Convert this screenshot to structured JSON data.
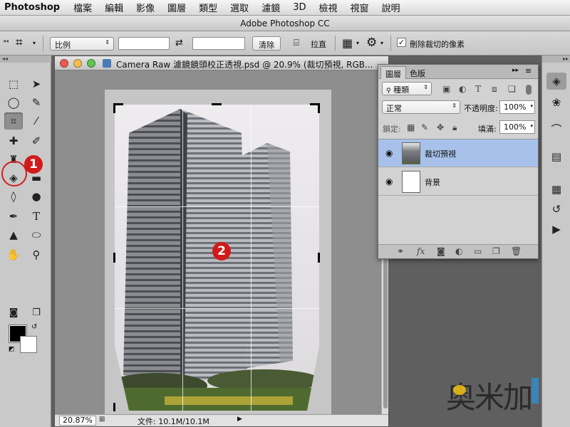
{
  "menubar": {
    "app": "Photoshop",
    "items": [
      "檔案",
      "編輯",
      "影像",
      "圖層",
      "類型",
      "選取",
      "濾鏡",
      "3D",
      "檢視",
      "視窗",
      "說明"
    ]
  },
  "window_title": "Adobe Photoshop CC",
  "options_bar": {
    "ratio_select": "比例",
    "clear_button": "清除",
    "straighten_label": "拉直",
    "delete_cropped_label": "刪除裁切的像素",
    "delete_cropped_checked": true
  },
  "document": {
    "title": "Camera Raw 濾鏡鏡頭校正透視.psd @ 20.9% (裁切預視, RGB...",
    "zoom": "20.87%",
    "status": "文件: 10.1M/10.1M"
  },
  "layers_panel": {
    "tabs": [
      "圖層",
      "色版"
    ],
    "filter_label": "種類",
    "blend_mode": "正常",
    "opacity_label": "不透明度:",
    "opacity_value": "100%",
    "lock_label": "鎖定:",
    "fill_label": "填滿:",
    "fill_value": "100%",
    "layers": [
      {
        "name": "裁切預視",
        "selected": true
      },
      {
        "name": "背景",
        "selected": false
      }
    ]
  },
  "annotations": {
    "step1": "1",
    "step2": "2"
  },
  "watermark": {
    "text": "奥米加"
  },
  "colors": {
    "accent_red": "#d21a1a",
    "layer_selected": "#a7c1ea"
  }
}
